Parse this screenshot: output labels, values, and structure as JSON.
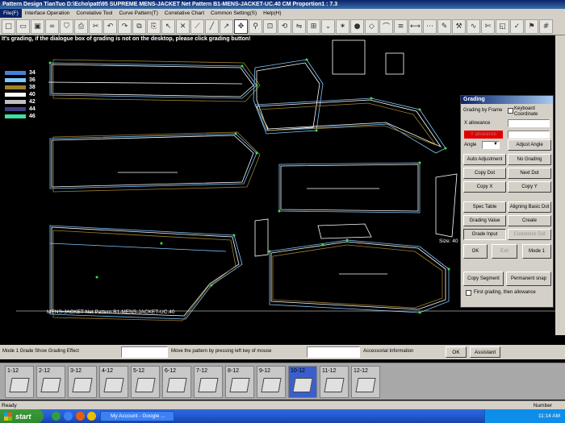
{
  "title_bar": "Pattern Design TianTuo D:\\Echo\\patt\\95 SUPREME MENS-JACKET Net Pattern B1-MENS-JACKET-UC.40    CM    Proportion1 : 7.3",
  "menu": [
    "File(F)",
    "Interface Operation",
    "Correlative Tool",
    "Curve Pattern(T)",
    "Correlative Chart",
    "Common Setting(S)",
    "Help(H)"
  ],
  "toolbar_icons": [
    "new-icon",
    "open-icon",
    "save-icon",
    "link-icon",
    "shirt-icon",
    "print-icon",
    "cut-icon",
    "undo-icon",
    "redo-icon",
    "copy-icon",
    "paste-icon",
    "pointer-icon",
    "cross-icon",
    "ruler-icon",
    "line-icon",
    "arrow-icon",
    "move-icon",
    "zoom-icon",
    "zoom-fit-icon",
    "rotate-icon",
    "mirror-icon",
    "grade-icon",
    "notch-icon",
    "mark-icon",
    "button-icon",
    "dart-icon",
    "fold-icon",
    "pleat-icon",
    "measure-icon",
    "seam-icon",
    "pen-icon",
    "tool-icon",
    "curve-icon",
    "scissors-icon",
    "piece-icon",
    "check-icon",
    "tag-icon",
    "grid-icon"
  ],
  "hint": "It's grading, if the dialogue box of grading is not on the desktop, please click grading button!",
  "legend": [
    {
      "label": "34",
      "color": "#4a7fd4"
    },
    {
      "label": "36",
      "color": "#7fc7ff"
    },
    {
      "label": "38",
      "color": "#a08030"
    },
    {
      "label": "40",
      "color": "#ffffff"
    },
    {
      "label": "42",
      "color": "#c0c0c0"
    },
    {
      "label": "44",
      "color": "#404080"
    },
    {
      "label": "46",
      "color": "#40e0a0"
    }
  ],
  "canvas": {
    "pattern_label": "MENS-JACKET Net Pattern B1-MENS-JACKET-UC.40",
    "size_label": "Size: 40"
  },
  "grading": {
    "title": "Grading",
    "grading_by_frame": "Grading by Frame",
    "keyboard_coordinate": "Keyboard Coordinate",
    "x_allowance": "X allowance",
    "y_allowance": "Y allowance",
    "angle": "Angle",
    "adjust_angle": "Adjust Angle",
    "auto_adjustment": "Auto Adjustment",
    "no_grading": "No Grading",
    "copy_dot": "Copy Dot",
    "next_dot": "Next Dot",
    "copy_x": "Copy  X",
    "copy_y": "Copy  Y",
    "spec_table": "Spec Table",
    "aligning_basic_dot": "Aligning Basic Dot",
    "grading_value": "Grading Value",
    "create": "Create",
    "grade_input": "Grade Input",
    "customize_dot": "Customize Dot",
    "ok": "OK",
    "exit": "Exit",
    "mode1": "Mode 1",
    "copy_segment": "Copy Segment",
    "permanent_snap": "Permanent snap",
    "first_grading": "First grading, then allowance"
  },
  "status": {
    "mode": "Mode 1 Grade  Show Grading Effect",
    "move_hint": "Move the pattern by pressing left key of mouse",
    "accessorial": "Accessorial Information",
    "ok": "OK",
    "assistant": "Assistant"
  },
  "thumbnails": [
    "1-12",
    "2-12",
    "3-12",
    "4-12",
    "5-12",
    "6-12",
    "7-12",
    "8-12",
    "9-12",
    "10-12",
    "11-12",
    "12-12"
  ],
  "selected_thumbnail": "10-12",
  "ready": "Ready",
  "number": "Number",
  "taskbar": {
    "start": "start",
    "app": "My Account - Google ...",
    "time": "11:14 AM"
  }
}
